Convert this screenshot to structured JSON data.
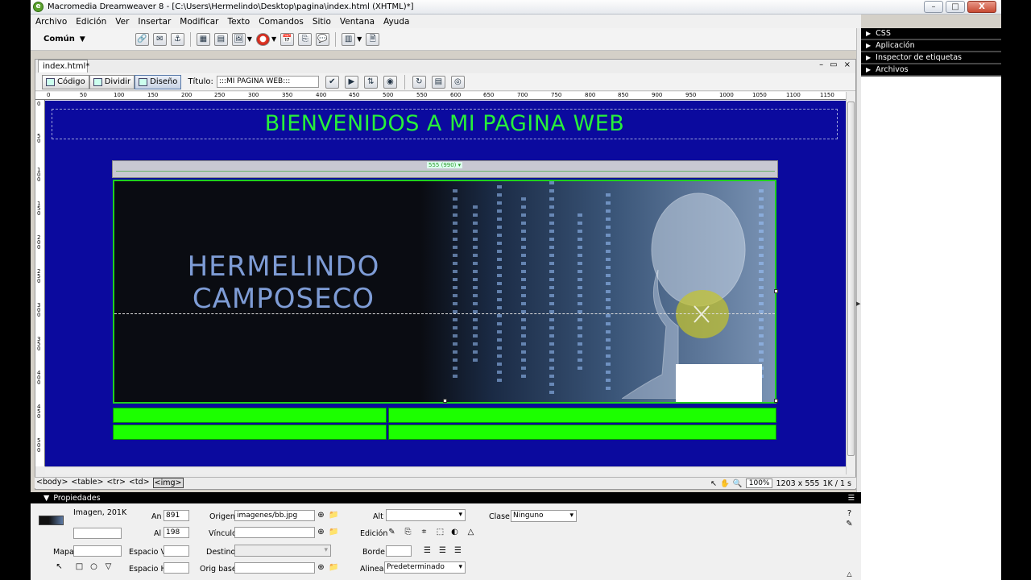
{
  "window": {
    "title": "Macromedia Dreamweaver 8 - [C:\\Users\\Hermelindo\\Desktop\\pagina\\index.html (XHTML)*]",
    "logo_letter": "e",
    "min": "–",
    "max": "□",
    "close": "X"
  },
  "menu": [
    "Archivo",
    "Edición",
    "Ver",
    "Insertar",
    "Modificar",
    "Texto",
    "Comandos",
    "Sitio",
    "Ventana",
    "Ayuda"
  ],
  "insert_bar": {
    "category": "Común",
    "dropdown_glyph": "▼",
    "icons": [
      "🔗",
      "✉",
      "⚓",
      "▦",
      "▤",
      "🖼",
      "●",
      "📅",
      "⎘",
      "💬",
      "▥",
      "🗎"
    ]
  },
  "panels": [
    {
      "label": "CSS",
      "glyph": "▶"
    },
    {
      "label": "Aplicación",
      "glyph": "▶"
    },
    {
      "label": "Inspector de etiquetas",
      "glyph": "▶"
    },
    {
      "label": "Archivos",
      "glyph": "▶"
    }
  ],
  "panel_collapse_glyph": "▶",
  "document": {
    "tab": "index.html*",
    "win_btns": [
      "–",
      "▭",
      "×"
    ],
    "views": [
      {
        "label": "Código",
        "active": false
      },
      {
        "label": "Dividir",
        "active": false
      },
      {
        "label": "Diseño",
        "active": true
      }
    ],
    "title_label": "Título:",
    "title_value": ":::MI PAGINA WEB:::",
    "toolbar_icons": [
      "✔",
      "▶",
      "⇅",
      "◉",
      "↻",
      "▤",
      "◎"
    ]
  },
  "ruler_h": [
    "0",
    "50",
    "100",
    "150",
    "200",
    "250",
    "300",
    "350",
    "400",
    "450",
    "500",
    "550",
    "600",
    "650",
    "700",
    "750",
    "800",
    "850",
    "900",
    "950",
    "1000",
    "1050",
    "1100",
    "1150"
  ],
  "ruler_v": [
    "0",
    "50",
    "100",
    "150",
    "200",
    "250",
    "300",
    "350",
    "400",
    "450",
    "500"
  ],
  "page": {
    "welcome": "BIENVENIDOS A MI PAGINA WEB",
    "table_width_label": "555 (990) ▾",
    "banner_line1": "HERMELINDO",
    "banner_line2": "CAMPOSECO",
    "colors": {
      "canvas": "#0b0a9e",
      "welcome": "#27f03a",
      "green_cells": "#1cff00",
      "banner_text": "#7e9cd6"
    }
  },
  "status": {
    "tags": [
      "<body>",
      "<table>",
      "<tr>",
      "<td>",
      "<img>"
    ],
    "zoom": "100%",
    "size": "1203 x 555",
    "download": "1K / 1 s",
    "tool_icons": [
      "↖",
      "✋",
      "🔍"
    ]
  },
  "properties": {
    "header": "Propiedades",
    "header_glyph": "▼",
    "help_glyph": "?",
    "edit_glyph": "✎",
    "menu_glyph": "☰",
    "type": "Imagen, 201K",
    "an_label": "An",
    "an_value": "891",
    "al_label": "Al",
    "al_value": "198",
    "origen_label": "Origen",
    "origen_value": "imagenes/bb.jpg",
    "vinculo_label": "Vínculo",
    "alt_label": "Alt",
    "clase_label": "Clase",
    "clase_value": "Ninguno",
    "edicion_label": "Edición",
    "mapa_label": "Mapa",
    "espacio_v_label": "Espacio V",
    "destino_label": "Destino",
    "borde_label": "Borde",
    "espacio_h_label": "Espacio H",
    "orig_base_label": "Orig base",
    "alinear_label": "Alinear",
    "alinear_value": "Predeterminado",
    "folder_glyph": "📁",
    "point_glyph": "⊕",
    "align_glyphs": [
      "☰",
      "☰",
      "☰"
    ],
    "map_tools": [
      "↖",
      "□",
      "○",
      "▽"
    ],
    "edit_tools": [
      "✎",
      "⎘",
      "⌗",
      "⬚",
      "◐",
      "△"
    ],
    "expand_glyph": "△"
  }
}
